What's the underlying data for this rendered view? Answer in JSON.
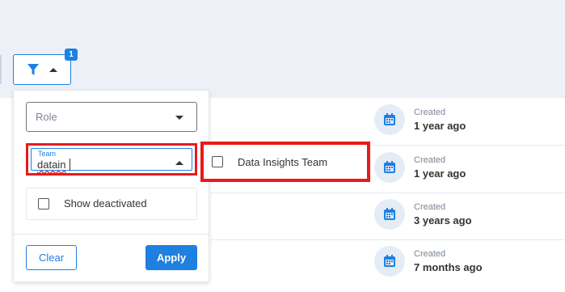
{
  "toolbar": {
    "filter_icon": "funnel-icon",
    "filter_badge": "1"
  },
  "filter_panel": {
    "role_placeholder": "Role",
    "team_label": "Team",
    "team_value": "datain",
    "show_deactivated_label": "Show deactivated",
    "clear_label": "Clear",
    "apply_label": "Apply"
  },
  "team_options": [
    {
      "label": "Data Insights Team",
      "checked": false
    }
  ],
  "rows": [
    {
      "created_label": "Created",
      "created_value": "1 year ago"
    },
    {
      "created_label": "Created",
      "created_value": "1 year ago"
    },
    {
      "created_label": "Created",
      "created_value": "3 years ago"
    },
    {
      "created_label": "Created",
      "created_value": "7 months ago"
    }
  ],
  "colors": {
    "accent": "#1e80e0",
    "highlight": "#e81a1a"
  }
}
